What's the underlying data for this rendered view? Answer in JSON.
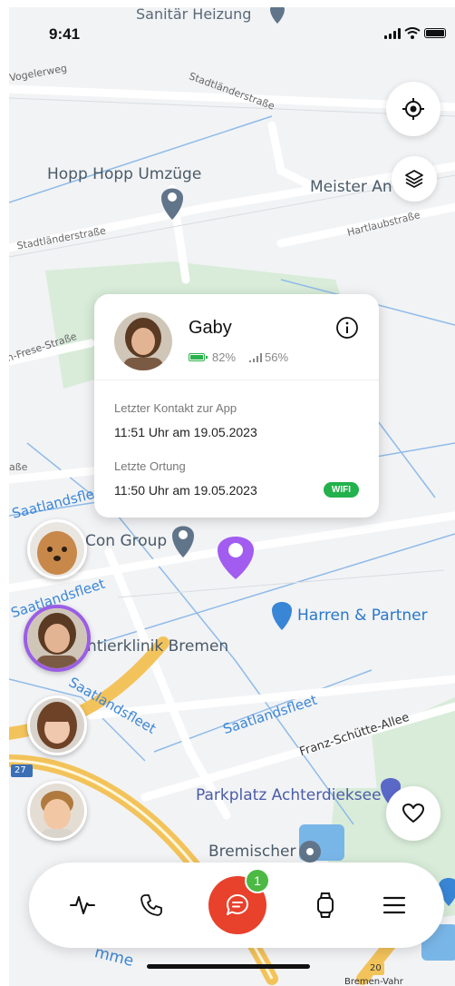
{
  "status": {
    "time": "9:41"
  },
  "map": {
    "labels": {
      "sanitaer": "Sanitär Heizung",
      "vogelerweg": "Vogelerweg",
      "stadtlaender1": "Stadtländerstraße",
      "stadtlaender2": "Stadtländerstraße",
      "hopp": "Hopp Hopp Umzüge",
      "meister": "Meister An",
      "hartlaub": "Hartlaubstraße",
      "frese": "n-Frese-Straße",
      "sse": "aße",
      "saatland1": "Saatlandsfleet",
      "congroup": "Con Group",
      "saatland2": "Saatlandsfleet",
      "harren": "Harren & Partner",
      "tierklinik": "ntierklinik Bremen",
      "saatland3": "Saatlandsfleet",
      "saatland4": "Saatlandsfleet",
      "franz": "Franz-Schütte-Allee",
      "route27": "27",
      "parkplatz": "Parkplatz Achterdieksee",
      "bremischer": "Bremischer",
      "mme": "mme",
      "route20": "20",
      "vahr": "Bremen-Vahr"
    },
    "icons": {
      "locate": "crosshair-icon",
      "layers": "layers-icon",
      "favorite": "heart-icon"
    }
  },
  "card": {
    "name": "Gaby",
    "battery": "82%",
    "signal": "56%",
    "last_contact_label": "Letzter Kontakt zur App",
    "last_contact_value": "11:51 Uhr am 19.05.2023",
    "last_location_label": "Letzte Ortung",
    "last_location_value": "11:50 Uhr am 19.05.2023",
    "connection": "WIFI"
  },
  "nav": {
    "icons": [
      "activity-icon",
      "phone-icon",
      "chat-icon",
      "watch-icon",
      "menu-icon"
    ],
    "chat_badge": "1"
  },
  "colors": {
    "accent": "#e8412c",
    "selected": "#9b5de5",
    "success": "#22b14c",
    "badge": "#4cb944"
  }
}
